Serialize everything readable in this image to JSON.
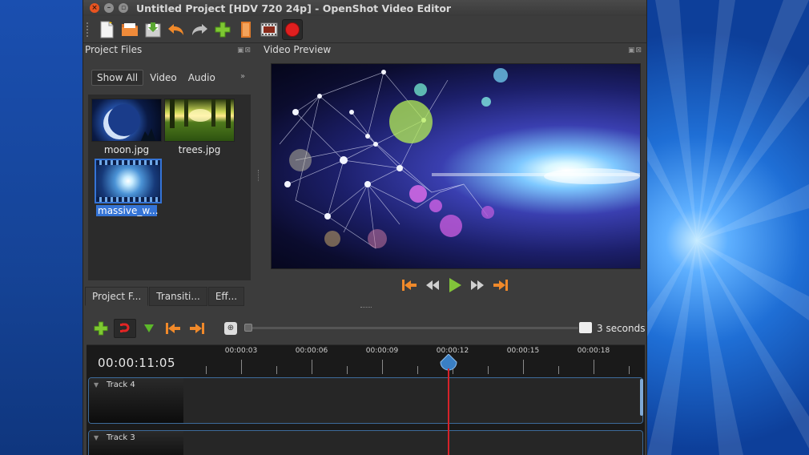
{
  "window": {
    "title": "Untitled Project [HDV 720 24p] - OpenShot Video Editor"
  },
  "toolbar": {
    "buttons": [
      {
        "name": "new-project",
        "icon": "new-file-icon"
      },
      {
        "name": "open-project",
        "icon": "folder-icon"
      },
      {
        "name": "save-project",
        "icon": "save-icon"
      },
      {
        "name": "undo",
        "icon": "undo-icon"
      },
      {
        "name": "redo",
        "icon": "redo-icon"
      },
      {
        "name": "import-files",
        "icon": "plus-icon"
      },
      {
        "name": "choose-profile",
        "icon": "profile-icon"
      },
      {
        "name": "fullscreen",
        "icon": "film-icon"
      },
      {
        "name": "export-video",
        "icon": "record-icon"
      }
    ]
  },
  "project_files": {
    "header": "Project Files",
    "filters": [
      "Show All",
      "Video",
      "Audio"
    ],
    "filter_more": "»",
    "files": [
      {
        "name": "moon.jpg"
      },
      {
        "name": "trees.jpg"
      },
      {
        "name": "massive_w..."
      }
    ],
    "tabs": [
      "Project F...",
      "Transiti...",
      "Eff..."
    ]
  },
  "video_preview": {
    "header": "Video Preview"
  },
  "timeline": {
    "duration_label": "3 seconds",
    "timecode": "00:00:11:05",
    "ruler_labels": [
      "00:00:03",
      "00:00:06",
      "00:00:09",
      "00:00:12",
      "00:00:15",
      "00:00:18"
    ],
    "tracks": [
      {
        "label": "Track 4"
      },
      {
        "label": "Track 3"
      }
    ]
  },
  "colors": {
    "accent_orange": "#f0892a",
    "accent_green": "#7ec832",
    "selection_blue": "#3574d6",
    "playhead_red": "#d6222a"
  }
}
